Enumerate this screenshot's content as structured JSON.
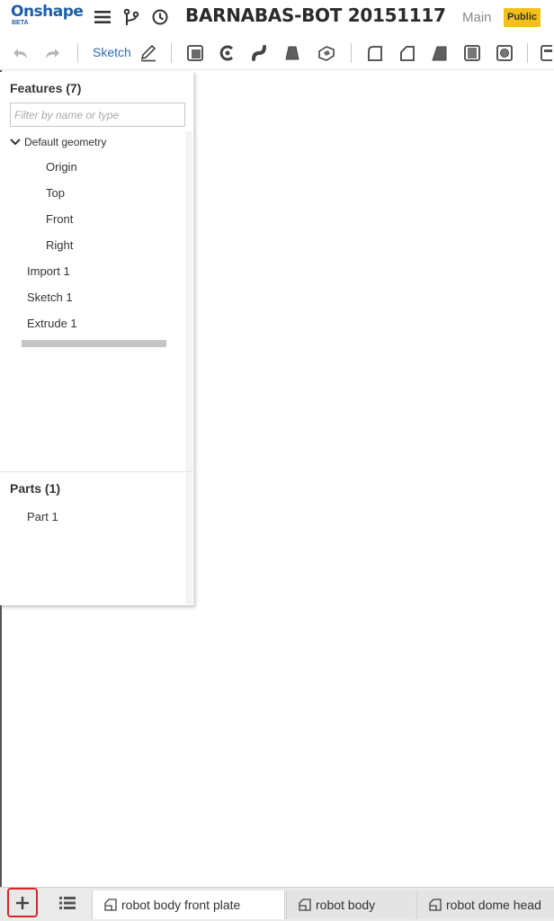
{
  "app": {
    "logo_text": "Onshape",
    "logo_sub": "BETA",
    "document_title": "BARNABAS-BOT 20151117",
    "workspace": "Main",
    "visibility_badge": "Public"
  },
  "header_icons": [
    "menu-icon",
    "branch-icon",
    "history-icon"
  ],
  "toolbar": {
    "sketch_label": "Sketch",
    "icons": [
      "undo-icon",
      "redo-icon",
      "sketch-pencil-icon",
      "extrude-icon",
      "revolve-icon",
      "sweep-icon",
      "loft-icon",
      "thicken-icon",
      "fillet-icon",
      "chamfer-icon",
      "draft-icon",
      "shell-icon",
      "hole-icon",
      "more-icon"
    ]
  },
  "features_panel": {
    "title": "Features (7)",
    "filter_placeholder": "Filter by name or type",
    "group_label": "Default geometry",
    "default_geometry": [
      "Origin",
      "Top",
      "Front",
      "Right"
    ],
    "features": [
      "Import 1",
      "Sketch 1",
      "Extrude 1"
    ],
    "parts_title": "Parts (1)",
    "parts": [
      "Part 1"
    ]
  },
  "tabs": {
    "items": [
      "robot body front plate",
      "robot body",
      "robot dome head"
    ],
    "active_index": 0
  },
  "colors": {
    "brand": "#1b5fa7",
    "badge": "#f3c019",
    "highlight": "#d9252a"
  }
}
